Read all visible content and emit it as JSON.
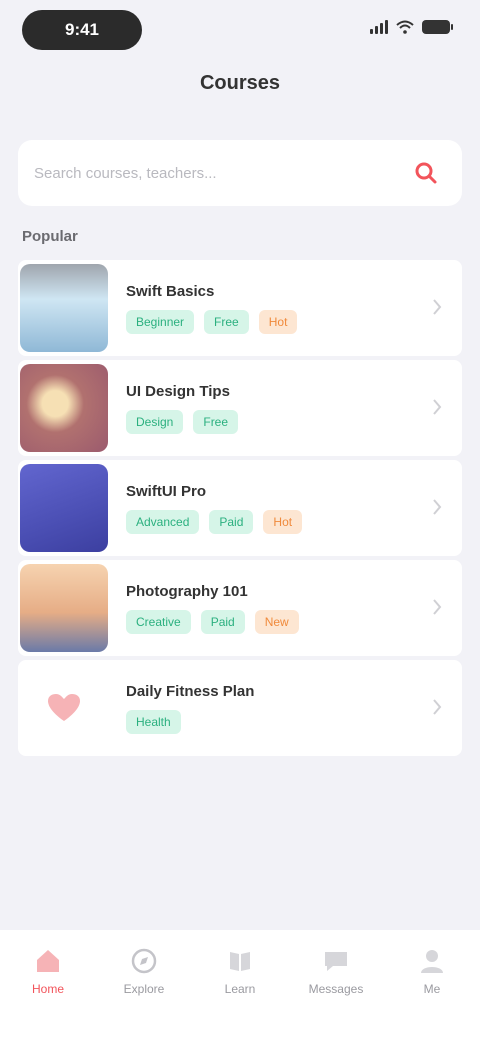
{
  "status_bar": {
    "time": "9:41"
  },
  "header": {
    "title": "Courses"
  },
  "search": {
    "placeholder": "Search courses, teachers...",
    "button_icon": "search-icon"
  },
  "section": {
    "title": "Popular"
  },
  "items": [
    {
      "title": "Swift Basics",
      "tag1": "Beginner",
      "tag2": "Free",
      "badge": "Hot",
      "thumb_colors": [
        "#cfe6f3",
        "#8fb8d6"
      ]
    },
    {
      "title": "UI Design Tips",
      "tag1": "Design",
      "tag2": "Free",
      "badge": "",
      "thumb_colors": [
        "#e7a9a9",
        "#9b5a6e"
      ]
    },
    {
      "title": "SwiftUI Pro",
      "tag1": "Advanced",
      "tag2": "Paid",
      "badge": "Hot",
      "thumb_colors": [
        "#5a5fc6",
        "#3c3fa0"
      ]
    },
    {
      "title": "Photography 101",
      "tag1": "Creative",
      "tag2": "Paid",
      "badge": "New",
      "thumb_colors": [
        "#f2c49b",
        "#6a7aa8"
      ]
    },
    {
      "title": "Daily Fitness Plan",
      "tag1": "Health",
      "tag2": "",
      "badge": "",
      "thumb_colors": [
        "#ffffff",
        "#f7dede"
      ]
    }
  ],
  "tabs": [
    {
      "label": "Home",
      "icon": "home-icon"
    },
    {
      "label": "Explore",
      "icon": "compass-icon"
    },
    {
      "label": "Learn",
      "icon": "book-icon"
    },
    {
      "label": "Messages",
      "icon": "chat-icon"
    },
    {
      "label": "Me",
      "icon": "person-icon"
    }
  ],
  "colors": {
    "accent": "#f2545b",
    "tag_green": "#2bb07f",
    "tag_orange": "#f08a3c",
    "background": "#f2f2f7"
  }
}
